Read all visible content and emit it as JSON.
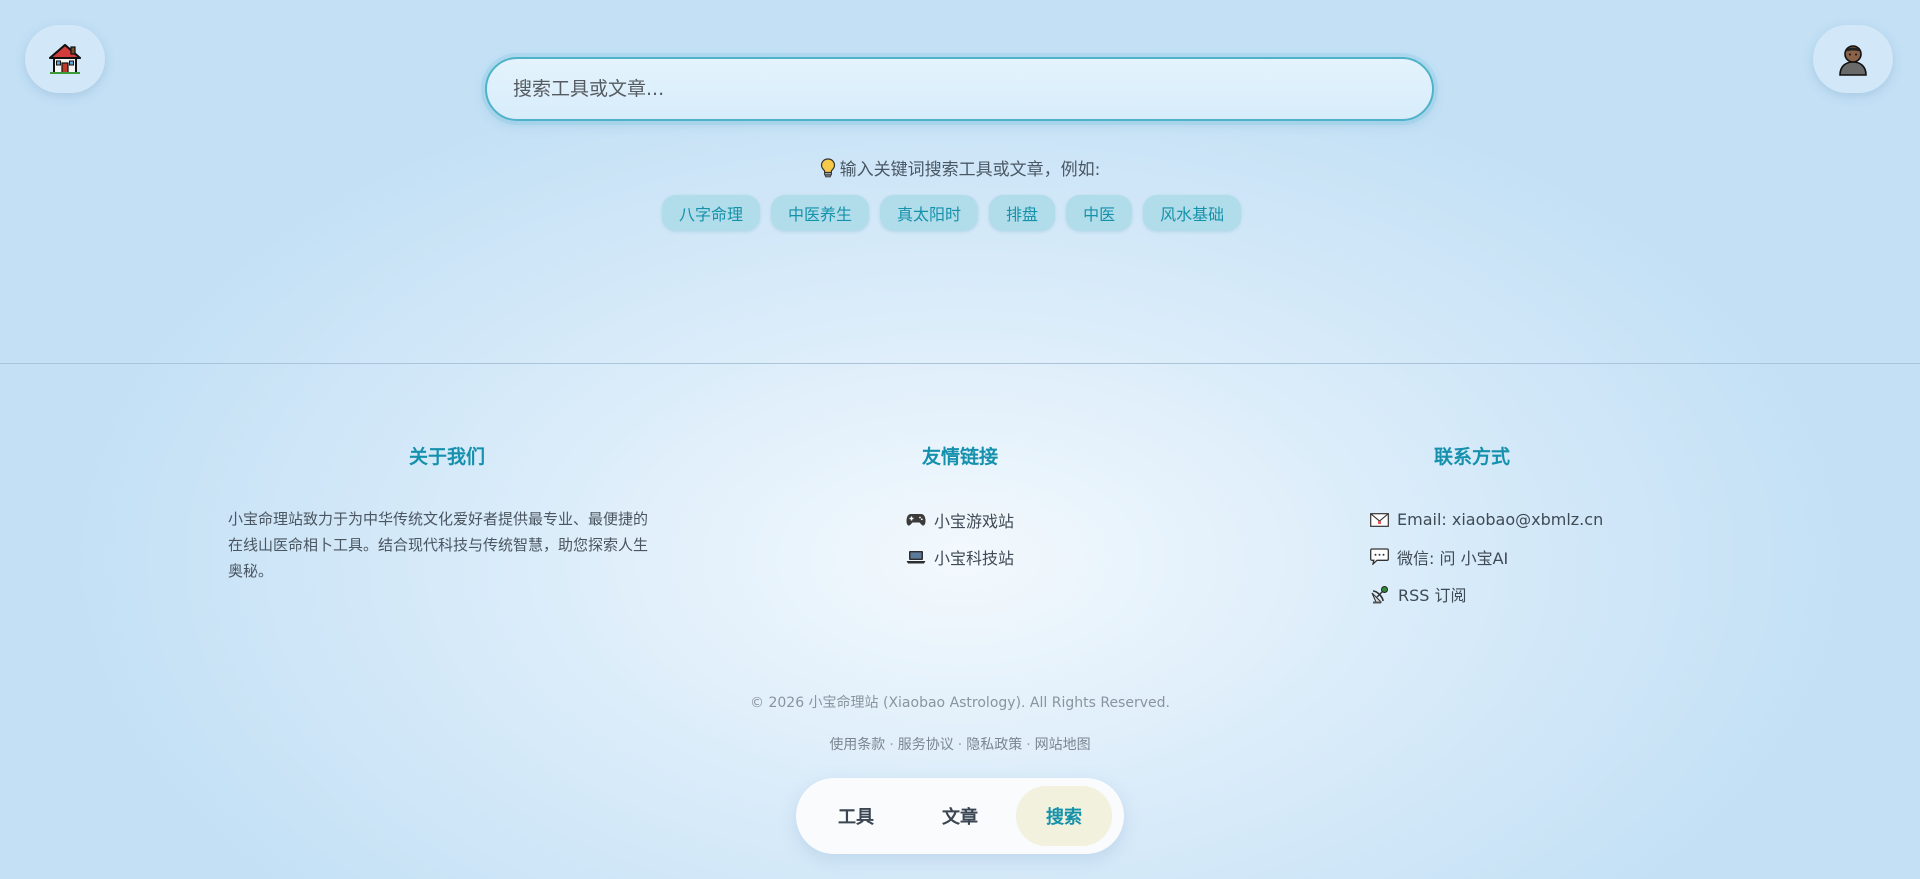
{
  "header": {
    "home_icon": "house-icon",
    "user_icon": "user-avatar-icon"
  },
  "search": {
    "placeholder": "搜索工具或文章...",
    "hint": "输入关键词搜索工具或文章，例如:",
    "hint_icon": "lightbulb-icon",
    "tags": [
      "八字命理",
      "中医养生",
      "真太阳时",
      "排盘",
      "中医",
      "风水基础"
    ]
  },
  "footer": {
    "about": {
      "title": "关于我们",
      "text": "小宝命理站致力于为中华传统文化爱好者提供最专业、最便捷的在线山医命相卜工具。结合现代科技与传统智慧，助您探索人生奥秘。"
    },
    "friends": {
      "title": "友情链接",
      "links": [
        {
          "icon": "gamepad-icon",
          "label": "小宝游戏站"
        },
        {
          "icon": "laptop-icon",
          "label": "小宝科技站"
        }
      ]
    },
    "contact": {
      "title": "联系方式",
      "items": [
        {
          "icon": "email-icon",
          "label": "Email: xiaobao@xbmlz.cn"
        },
        {
          "icon": "chat-icon",
          "label": "微信: 问  小宝AI"
        },
        {
          "icon": "satellite-icon",
          "label": "RSS 订阅"
        }
      ]
    },
    "copyright": "© 2026 小宝命理站 (Xiaobao Astrology). All Rights Reserved.",
    "legal_links": [
      "使用条款",
      "服务协议",
      "隐私政策",
      "网站地图"
    ]
  },
  "bottom_nav": {
    "items": [
      {
        "label": "工具",
        "active": false
      },
      {
        "label": "文章",
        "active": false
      },
      {
        "label": "搜索",
        "active": true
      }
    ]
  },
  "colors": {
    "accent": "#1592aa",
    "tag_bg": "#b1dcea",
    "search_border": "#4fb2c9"
  }
}
